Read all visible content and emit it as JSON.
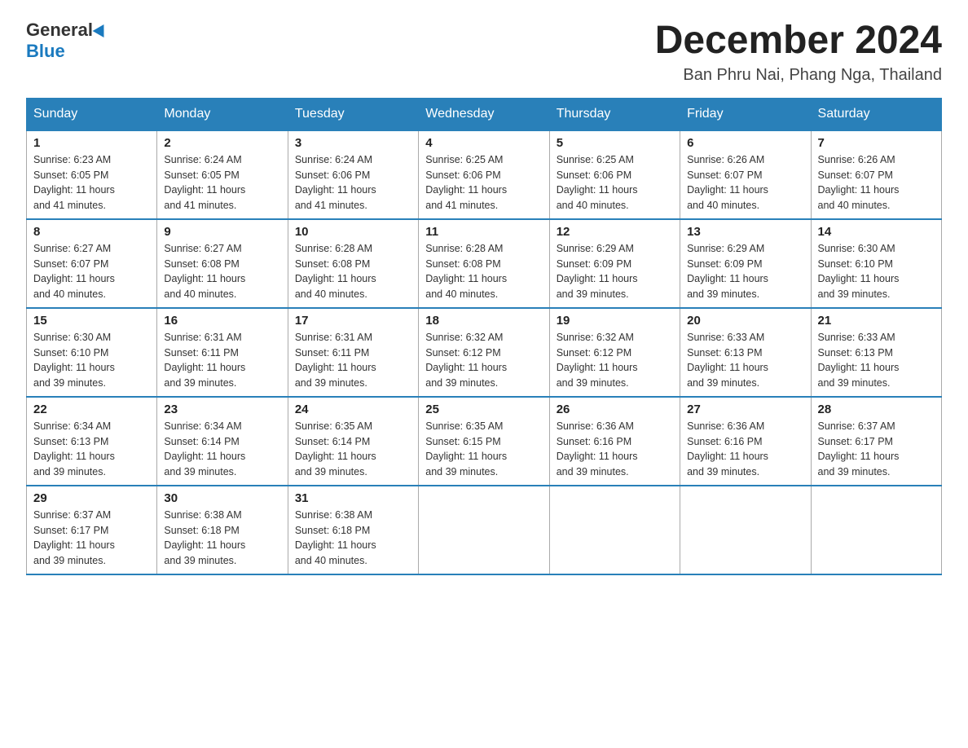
{
  "header": {
    "logo_general": "General",
    "logo_blue": "Blue",
    "title": "December 2024",
    "subtitle": "Ban Phru Nai, Phang Nga, Thailand"
  },
  "days_of_week": [
    "Sunday",
    "Monday",
    "Tuesday",
    "Wednesday",
    "Thursday",
    "Friday",
    "Saturday"
  ],
  "weeks": [
    [
      {
        "day": "1",
        "sunrise": "6:23 AM",
        "sunset": "6:05 PM",
        "daylight": "11 hours and 41 minutes."
      },
      {
        "day": "2",
        "sunrise": "6:24 AM",
        "sunset": "6:05 PM",
        "daylight": "11 hours and 41 minutes."
      },
      {
        "day": "3",
        "sunrise": "6:24 AM",
        "sunset": "6:06 PM",
        "daylight": "11 hours and 41 minutes."
      },
      {
        "day": "4",
        "sunrise": "6:25 AM",
        "sunset": "6:06 PM",
        "daylight": "11 hours and 41 minutes."
      },
      {
        "day": "5",
        "sunrise": "6:25 AM",
        "sunset": "6:06 PM",
        "daylight": "11 hours and 40 minutes."
      },
      {
        "day": "6",
        "sunrise": "6:26 AM",
        "sunset": "6:07 PM",
        "daylight": "11 hours and 40 minutes."
      },
      {
        "day": "7",
        "sunrise": "6:26 AM",
        "sunset": "6:07 PM",
        "daylight": "11 hours and 40 minutes."
      }
    ],
    [
      {
        "day": "8",
        "sunrise": "6:27 AM",
        "sunset": "6:07 PM",
        "daylight": "11 hours and 40 minutes."
      },
      {
        "day": "9",
        "sunrise": "6:27 AM",
        "sunset": "6:08 PM",
        "daylight": "11 hours and 40 minutes."
      },
      {
        "day": "10",
        "sunrise": "6:28 AM",
        "sunset": "6:08 PM",
        "daylight": "11 hours and 40 minutes."
      },
      {
        "day": "11",
        "sunrise": "6:28 AM",
        "sunset": "6:08 PM",
        "daylight": "11 hours and 40 minutes."
      },
      {
        "day": "12",
        "sunrise": "6:29 AM",
        "sunset": "6:09 PM",
        "daylight": "11 hours and 39 minutes."
      },
      {
        "day": "13",
        "sunrise": "6:29 AM",
        "sunset": "6:09 PM",
        "daylight": "11 hours and 39 minutes."
      },
      {
        "day": "14",
        "sunrise": "6:30 AM",
        "sunset": "6:10 PM",
        "daylight": "11 hours and 39 minutes."
      }
    ],
    [
      {
        "day": "15",
        "sunrise": "6:30 AM",
        "sunset": "6:10 PM",
        "daylight": "11 hours and 39 minutes."
      },
      {
        "day": "16",
        "sunrise": "6:31 AM",
        "sunset": "6:11 PM",
        "daylight": "11 hours and 39 minutes."
      },
      {
        "day": "17",
        "sunrise": "6:31 AM",
        "sunset": "6:11 PM",
        "daylight": "11 hours and 39 minutes."
      },
      {
        "day": "18",
        "sunrise": "6:32 AM",
        "sunset": "6:12 PM",
        "daylight": "11 hours and 39 minutes."
      },
      {
        "day": "19",
        "sunrise": "6:32 AM",
        "sunset": "6:12 PM",
        "daylight": "11 hours and 39 minutes."
      },
      {
        "day": "20",
        "sunrise": "6:33 AM",
        "sunset": "6:13 PM",
        "daylight": "11 hours and 39 minutes."
      },
      {
        "day": "21",
        "sunrise": "6:33 AM",
        "sunset": "6:13 PM",
        "daylight": "11 hours and 39 minutes."
      }
    ],
    [
      {
        "day": "22",
        "sunrise": "6:34 AM",
        "sunset": "6:13 PM",
        "daylight": "11 hours and 39 minutes."
      },
      {
        "day": "23",
        "sunrise": "6:34 AM",
        "sunset": "6:14 PM",
        "daylight": "11 hours and 39 minutes."
      },
      {
        "day": "24",
        "sunrise": "6:35 AM",
        "sunset": "6:14 PM",
        "daylight": "11 hours and 39 minutes."
      },
      {
        "day": "25",
        "sunrise": "6:35 AM",
        "sunset": "6:15 PM",
        "daylight": "11 hours and 39 minutes."
      },
      {
        "day": "26",
        "sunrise": "6:36 AM",
        "sunset": "6:16 PM",
        "daylight": "11 hours and 39 minutes."
      },
      {
        "day": "27",
        "sunrise": "6:36 AM",
        "sunset": "6:16 PM",
        "daylight": "11 hours and 39 minutes."
      },
      {
        "day": "28",
        "sunrise": "6:37 AM",
        "sunset": "6:17 PM",
        "daylight": "11 hours and 39 minutes."
      }
    ],
    [
      {
        "day": "29",
        "sunrise": "6:37 AM",
        "sunset": "6:17 PM",
        "daylight": "11 hours and 39 minutes."
      },
      {
        "day": "30",
        "sunrise": "6:38 AM",
        "sunset": "6:18 PM",
        "daylight": "11 hours and 39 minutes."
      },
      {
        "day": "31",
        "sunrise": "6:38 AM",
        "sunset": "6:18 PM",
        "daylight": "11 hours and 40 minutes."
      },
      null,
      null,
      null,
      null
    ]
  ],
  "labels": {
    "sunrise": "Sunrise:",
    "sunset": "Sunset:",
    "daylight": "Daylight:"
  }
}
